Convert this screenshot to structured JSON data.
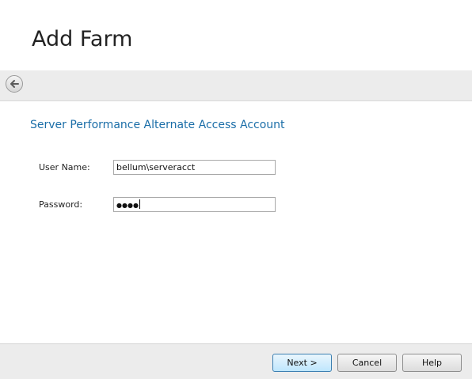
{
  "window": {
    "title": "Add Farm"
  },
  "nav": {
    "back_icon": "back-arrow-icon"
  },
  "section": {
    "title": "Server Performance Alternate Access Account"
  },
  "form": {
    "username_label": "User Name:",
    "username_value": "bellum\\serveracct",
    "password_label": "Password:",
    "password_masked": "●●●●"
  },
  "footer": {
    "next_label": "Next >",
    "cancel_label": "Cancel",
    "help_label": "Help"
  },
  "colors": {
    "accent": "#1b6ea8",
    "bar_bg": "#ececec"
  }
}
